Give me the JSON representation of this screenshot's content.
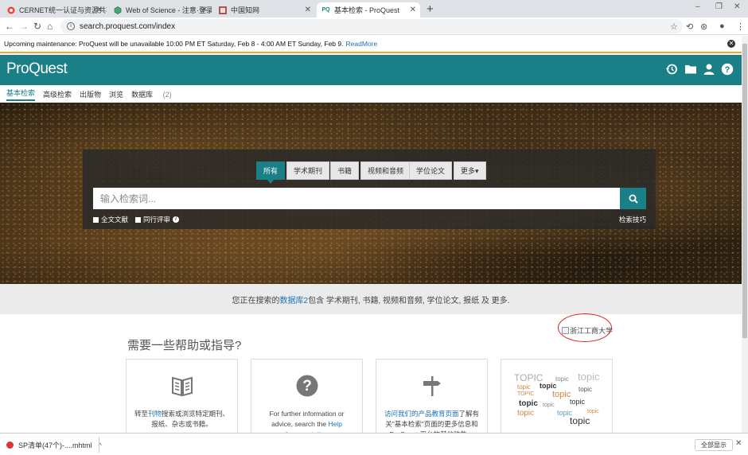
{
  "browser": {
    "tabs": [
      {
        "title": "CERNET统一认证与资源共享基础...",
        "favicon": "cernet-icon",
        "active": false
      },
      {
        "title": "Web of Science - 注意·登录错误",
        "favicon": "wos-icon",
        "active": false
      },
      {
        "title": "中国知网",
        "favicon": "cnki-icon",
        "active": false
      },
      {
        "title": "基本检索 - ProQuest",
        "favicon": "proquest-icon",
        "favicon_text": "PQ",
        "active": true
      }
    ],
    "url": "search.proquest.com/index"
  },
  "maintenance": {
    "message": "Upcoming maintenance: ProQuest will be unavailable 10:00 PM ET Saturday, Feb 8 - 4:00 AM ET Sunday, Feb 9.",
    "link": "ReadMore"
  },
  "header": {
    "logo": "ProQuest",
    "accent": "#1a7f86",
    "icons": [
      "recent-searches-icon",
      "folder-icon",
      "user-icon",
      "help-icon"
    ]
  },
  "subnav": {
    "items": [
      "基本检索",
      "高级检索",
      "出版物",
      "浏览",
      "数据库"
    ],
    "db_count": "(2)"
  },
  "search": {
    "source_tabs": [
      "所有",
      "学术期刊",
      "书籍",
      "视频和音频",
      "学位论文",
      "更多▾"
    ],
    "placeholder": "输入检索词...",
    "fulltext_label": "全文文献",
    "peer_review_label": "同行评审",
    "tips_label": "检索技巧"
  },
  "db_line": {
    "prefix": "您正在搜索的",
    "link": "数据库2",
    "suffix": "包含 学术期刊, 书籍, 视频和音频, 学位论文, 报纸 及 更多."
  },
  "help": {
    "title": "需要一些帮助或指导?",
    "institution_logo_alt": "浙江工商大学",
    "cards": [
      {
        "icon": "book-icon",
        "pre": "转至",
        "link": "刊物",
        "post": "搜索或浏览特定期刊、报纸、杂志或书籍。"
      },
      {
        "icon": "question-icon",
        "pre": "For further information or advice, search the ",
        "link": "Help documentation",
        "post": "."
      },
      {
        "icon": "signpost-icon",
        "link": "访问我们的产品教育页面",
        "post": "了解有关\"基本检索\"页面的更多信息和 ProQuest 平台的其他功能。"
      },
      {
        "icon": "topic-cloud-icon",
        "words": [
          "TOPIC",
          "topic",
          "topic",
          "topic",
          "topic",
          "topic",
          "topic",
          "TOPIC",
          "topic",
          "topic",
          "topic",
          "topic",
          "topic",
          "topic",
          "topic"
        ]
      }
    ]
  },
  "downloads": {
    "file": "SP清单(47个)-....mhtml",
    "show_all": "全部显示"
  }
}
